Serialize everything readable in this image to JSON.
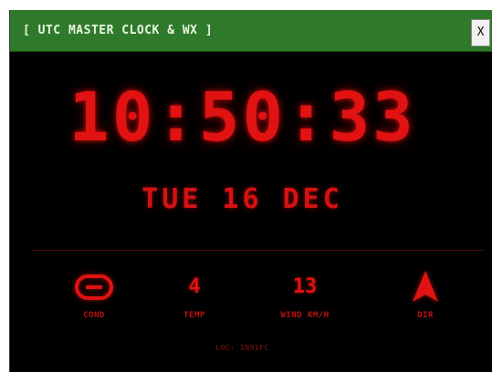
{
  "window": {
    "title": "[ UTC MASTER CLOCK & WX ]",
    "close_label": "X"
  },
  "clock": {
    "time": "10:50:33",
    "date": "TUE 16 DEC"
  },
  "weather": {
    "cond": {
      "icon": "cloud-icon",
      "label": "COND"
    },
    "temp": {
      "value": "4",
      "label": "TEMP"
    },
    "wind": {
      "value": "13",
      "label": "WIND KM/H"
    },
    "dir": {
      "icon": "arrow-up-icon",
      "label": "DIR"
    }
  },
  "location": "LOC: IN91FC",
  "colors": {
    "titlebar": "#2f7a2a",
    "background": "#000000",
    "accent": "#e01212"
  }
}
